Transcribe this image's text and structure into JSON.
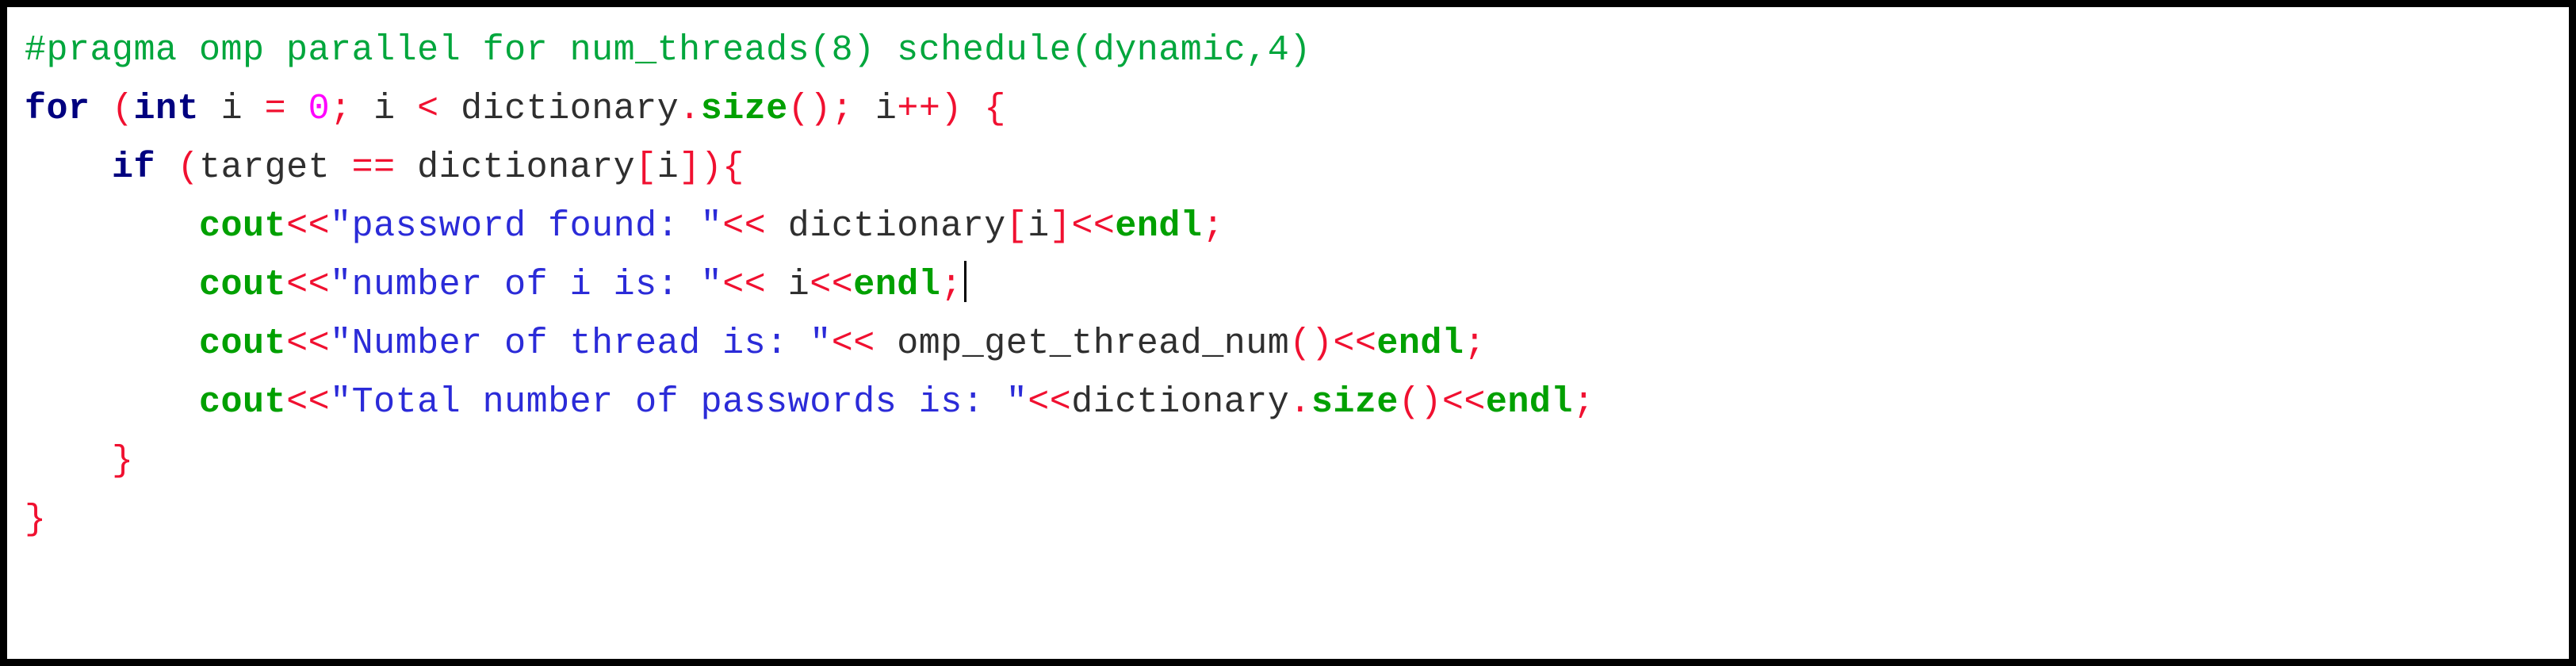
{
  "figure": {
    "kind": "code-snippet-screenshot",
    "language": "C++",
    "border_color": "#000000",
    "background_color": "#ffffff"
  },
  "palette": {
    "preprocessor": "#00a63c",
    "keyword": "#00007f",
    "member_function": "#00a000",
    "stream_object": "#00a000",
    "punctuation": "#f01030",
    "operator": "#f01030",
    "number": "#ff00ff",
    "string": "#2b2bd8",
    "identifier": "#2f2f2f"
  },
  "code": {
    "lines": [
      {
        "indent": "",
        "tokens": [
          {
            "text": "#pragma omp parallel for num_threads(8) schedule(dynamic,4)",
            "cls": "t-pre"
          }
        ]
      },
      {
        "indent": "",
        "tokens": [
          {
            "text": "for",
            "cls": "t-kw"
          },
          {
            "text": " ",
            "cls": "t-plain"
          },
          {
            "text": "(",
            "cls": "t-punc"
          },
          {
            "text": "int",
            "cls": "t-kw"
          },
          {
            "text": " i ",
            "cls": "t-id"
          },
          {
            "text": "=",
            "cls": "t-op"
          },
          {
            "text": " ",
            "cls": "t-plain"
          },
          {
            "text": "0",
            "cls": "t-num"
          },
          {
            "text": ";",
            "cls": "t-punc"
          },
          {
            "text": " i ",
            "cls": "t-id"
          },
          {
            "text": "<",
            "cls": "t-op"
          },
          {
            "text": " dictionary",
            "cls": "t-id"
          },
          {
            "text": ".",
            "cls": "t-punc"
          },
          {
            "text": "size",
            "cls": "t-fn"
          },
          {
            "text": "()",
            "cls": "t-punc"
          },
          {
            "text": ";",
            "cls": "t-punc"
          },
          {
            "text": " i",
            "cls": "t-id"
          },
          {
            "text": "++",
            "cls": "t-op"
          },
          {
            "text": ")",
            "cls": "t-punc"
          },
          {
            "text": " ",
            "cls": "t-plain"
          },
          {
            "text": "{",
            "cls": "t-punc"
          }
        ]
      },
      {
        "indent": "    ",
        "tokens": [
          {
            "text": "if",
            "cls": "t-kw"
          },
          {
            "text": " ",
            "cls": "t-plain"
          },
          {
            "text": "(",
            "cls": "t-punc"
          },
          {
            "text": "target ",
            "cls": "t-id"
          },
          {
            "text": "==",
            "cls": "t-op"
          },
          {
            "text": " dictionary",
            "cls": "t-id"
          },
          {
            "text": "[",
            "cls": "t-punc"
          },
          {
            "text": "i",
            "cls": "t-id"
          },
          {
            "text": "]",
            "cls": "t-punc"
          },
          {
            "text": ")",
            "cls": "t-punc"
          },
          {
            "text": "{",
            "cls": "t-punc"
          }
        ]
      },
      {
        "indent": "        ",
        "tokens": [
          {
            "text": "cout",
            "cls": "t-stream"
          },
          {
            "text": "<<",
            "cls": "t-op"
          },
          {
            "text": "\"password found: \"",
            "cls": "t-str"
          },
          {
            "text": "<<",
            "cls": "t-op"
          },
          {
            "text": " dictionary",
            "cls": "t-id"
          },
          {
            "text": "[",
            "cls": "t-punc"
          },
          {
            "text": "i",
            "cls": "t-id"
          },
          {
            "text": "]",
            "cls": "t-punc"
          },
          {
            "text": "<<",
            "cls": "t-op"
          },
          {
            "text": "endl",
            "cls": "t-stream"
          },
          {
            "text": ";",
            "cls": "t-punc"
          }
        ]
      },
      {
        "indent": "        ",
        "caret_after": true,
        "tokens": [
          {
            "text": "cout",
            "cls": "t-stream"
          },
          {
            "text": "<<",
            "cls": "t-op"
          },
          {
            "text": "\"number of i is: \"",
            "cls": "t-str"
          },
          {
            "text": "<<",
            "cls": "t-op"
          },
          {
            "text": " i",
            "cls": "t-id"
          },
          {
            "text": "<<",
            "cls": "t-op"
          },
          {
            "text": "endl",
            "cls": "t-stream"
          },
          {
            "text": ";",
            "cls": "t-punc"
          }
        ]
      },
      {
        "indent": "        ",
        "tokens": [
          {
            "text": "cout",
            "cls": "t-stream"
          },
          {
            "text": "<<",
            "cls": "t-op"
          },
          {
            "text": "\"Number of thread is: \"",
            "cls": "t-str"
          },
          {
            "text": "<<",
            "cls": "t-op"
          },
          {
            "text": " omp_get_thread_num",
            "cls": "t-id"
          },
          {
            "text": "()",
            "cls": "t-punc"
          },
          {
            "text": "<<",
            "cls": "t-op"
          },
          {
            "text": "endl",
            "cls": "t-stream"
          },
          {
            "text": ";",
            "cls": "t-punc"
          }
        ]
      },
      {
        "indent": "        ",
        "tokens": [
          {
            "text": "cout",
            "cls": "t-stream"
          },
          {
            "text": "<<",
            "cls": "t-op"
          },
          {
            "text": "\"Total number of passwords is: \"",
            "cls": "t-str"
          },
          {
            "text": "<<",
            "cls": "t-op"
          },
          {
            "text": "dictionary",
            "cls": "t-id"
          },
          {
            "text": ".",
            "cls": "t-punc"
          },
          {
            "text": "size",
            "cls": "t-fn"
          },
          {
            "text": "()",
            "cls": "t-punc"
          },
          {
            "text": "<<",
            "cls": "t-op"
          },
          {
            "text": "endl",
            "cls": "t-stream"
          },
          {
            "text": ";",
            "cls": "t-punc"
          }
        ]
      },
      {
        "indent": "    ",
        "tokens": [
          {
            "text": "}",
            "cls": "t-punc"
          }
        ]
      },
      {
        "indent": "",
        "tokens": [
          {
            "text": "}",
            "cls": "t-punc"
          }
        ]
      }
    ],
    "plain_text": "#pragma omp parallel for num_threads(8) schedule(dynamic,4)\nfor (int i = 0; i < dictionary.size(); i++) {\n    if (target == dictionary[i]){\n        cout<<\"password found: \"<< dictionary[i]<<endl;\n        cout<<\"number of i is: \"<< i<<endl;\n        cout<<\"Number of thread is: \"<< omp_get_thread_num()<<endl;\n        cout<<\"Total number of passwords is: \"<<dictionary.size()<<endl;\n    }\n}"
  }
}
